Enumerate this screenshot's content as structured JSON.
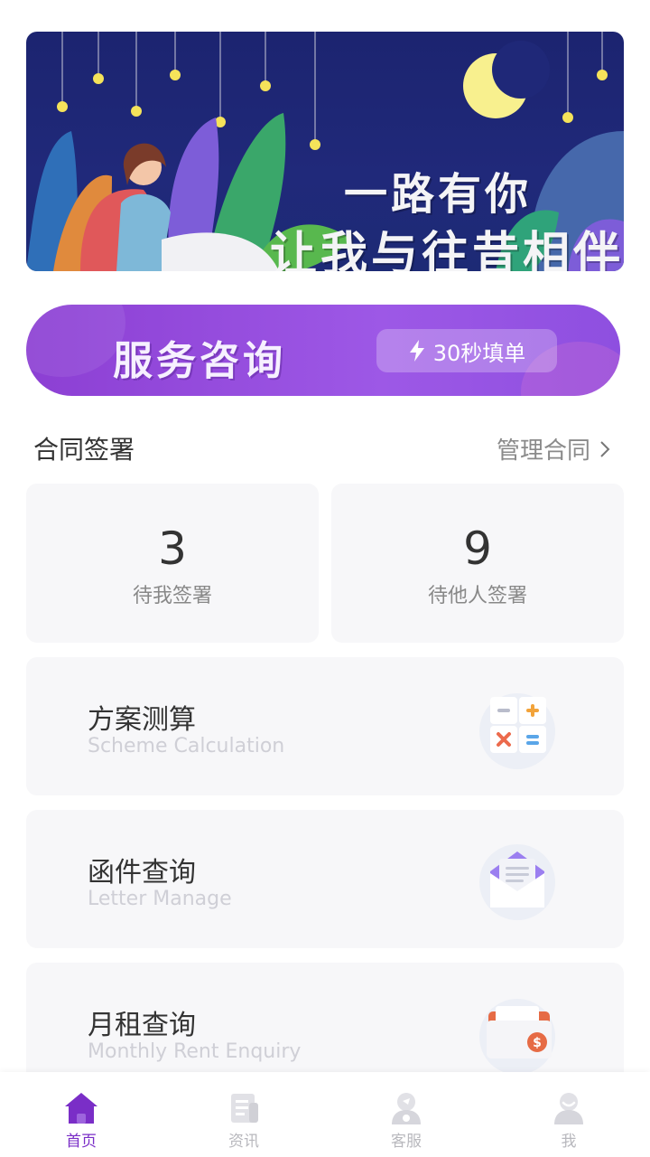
{
  "banner": {
    "line1": "一路有你",
    "line2": "让我与往昔相伴",
    "slides": 3,
    "active_slide": 1
  },
  "service": {
    "title": "服务咨询",
    "pill_label": "30秒填单"
  },
  "contract_section": {
    "title": "合同签署",
    "manage_label": "管理合同"
  },
  "stats": [
    {
      "value": "3",
      "label": "待我签署"
    },
    {
      "value": "9",
      "label": "待他人签署"
    }
  ],
  "features": [
    {
      "title": "方案测算",
      "subtitle": "Scheme Calculation",
      "icon": "calculator-icon"
    },
    {
      "title": "函件查询",
      "subtitle": "Letter Manage",
      "icon": "envelope-icon"
    },
    {
      "title": "月租查询",
      "subtitle": "Monthly Rent Enquiry",
      "icon": "wallet-icon"
    }
  ],
  "tabs": [
    {
      "label": "首页",
      "icon": "home-icon",
      "active": true
    },
    {
      "label": "资讯",
      "icon": "news-icon",
      "active": false
    },
    {
      "label": "客服",
      "icon": "customer-service-icon",
      "active": false
    },
    {
      "label": "我",
      "icon": "profile-icon",
      "active": false
    }
  ],
  "colors": {
    "accent": "#7a2ec7",
    "banner_bg": "#1f2878",
    "service_gradient_start": "#8c3fd3",
    "service_gradient_end": "#9d58e6",
    "card_bg": "#f7f7f9"
  }
}
